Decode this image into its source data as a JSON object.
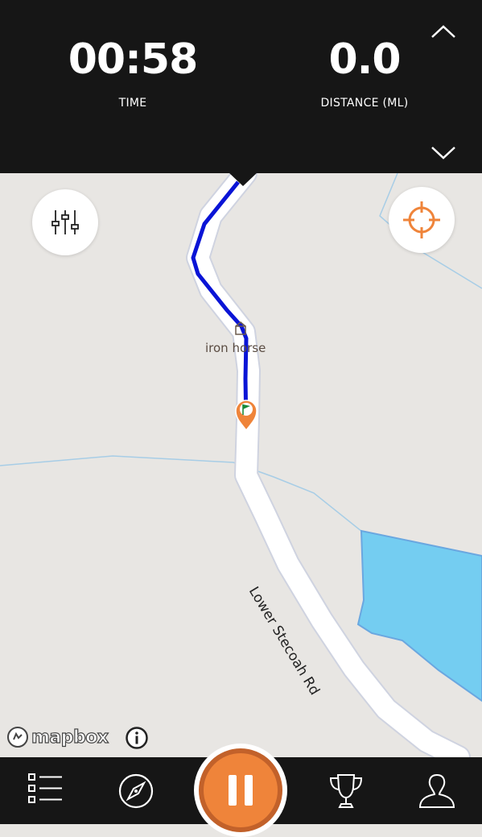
{
  "stats": {
    "time": {
      "value": "00:58",
      "label": "TIME"
    },
    "distance": {
      "value": "0.0",
      "label": "DISTANCE (ML)"
    }
  },
  "map": {
    "poi_label": "iron horse",
    "road_label": "Lower Stecoah Rd",
    "attribution": "mapbox"
  },
  "icons": {
    "collapse": "chevron-up-icon",
    "expand": "chevron-down-icon",
    "filters": "sliders-icon",
    "locate": "crosshair-icon",
    "start_marker": "flag-pin-icon",
    "info": "info-icon",
    "nav_list": "list-icon",
    "nav_explore": "compass-icon",
    "pause": "pause-icon",
    "nav_trophy": "trophy-icon",
    "nav_profile": "user-icon"
  },
  "colors": {
    "accent": "#ef843a",
    "track": "#0a14d6",
    "water": "#74cdf1",
    "bar": "#161616"
  }
}
